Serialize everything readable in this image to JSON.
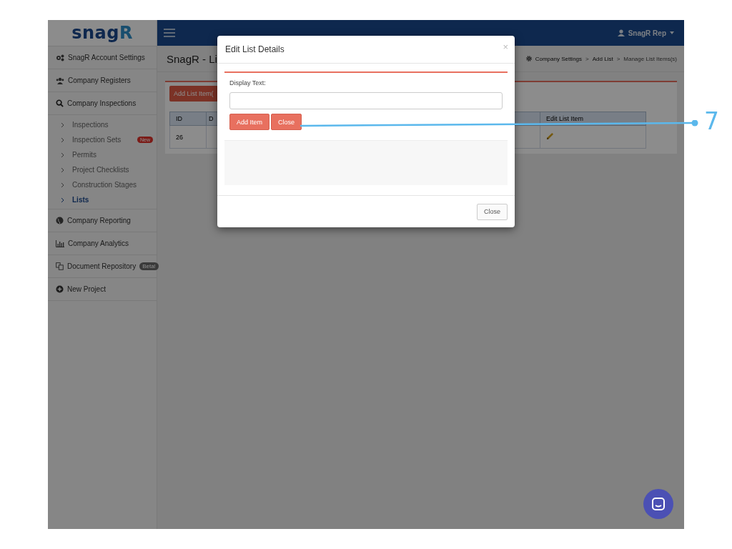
{
  "logo": {
    "main": "snag",
    "accent": "R"
  },
  "navbar": {
    "user": "SnagR Rep"
  },
  "sidebar": {
    "items": [
      {
        "label": "SnagR Account Settings"
      },
      {
        "label": "Company Registers"
      },
      {
        "label": "Company Inspections",
        "children": [
          {
            "label": "Inspections",
            "selected": false
          },
          {
            "label": "Inspection Sets",
            "selected": false,
            "badge": {
              "text": "New",
              "kind": "new"
            }
          },
          {
            "label": "Permits",
            "selected": false
          },
          {
            "label": "Project Checklists",
            "selected": false
          },
          {
            "label": "Construction Stages",
            "selected": false
          },
          {
            "label": "Lists",
            "selected": true
          }
        ]
      },
      {
        "label": "Company Reporting"
      },
      {
        "label": "Company Analytics"
      },
      {
        "label": "Document Repository",
        "badge": {
          "text": "Beta!",
          "kind": "beta"
        }
      },
      {
        "label": "New Project"
      }
    ]
  },
  "page": {
    "title": "SnagR - Li",
    "breadcrumb": [
      {
        "label": "Company Settings",
        "current": false
      },
      {
        "separator": ">"
      },
      {
        "label": "Add List",
        "current": false
      },
      {
        "separator": ">"
      },
      {
        "label": "Manage List Items(s)",
        "current": true
      }
    ],
    "add_button": "Add List Item(",
    "table": {
      "columns": [
        "ID",
        "D",
        "Edit List Item"
      ],
      "rows": [
        [
          "26"
        ]
      ]
    }
  },
  "modal": {
    "title": "Edit List Details",
    "close_glyph": "×",
    "field_label": "Display Text:",
    "buttons": [
      "Add Item",
      "Close"
    ],
    "footer_button": "Close"
  },
  "callout": {
    "number": "7"
  }
}
